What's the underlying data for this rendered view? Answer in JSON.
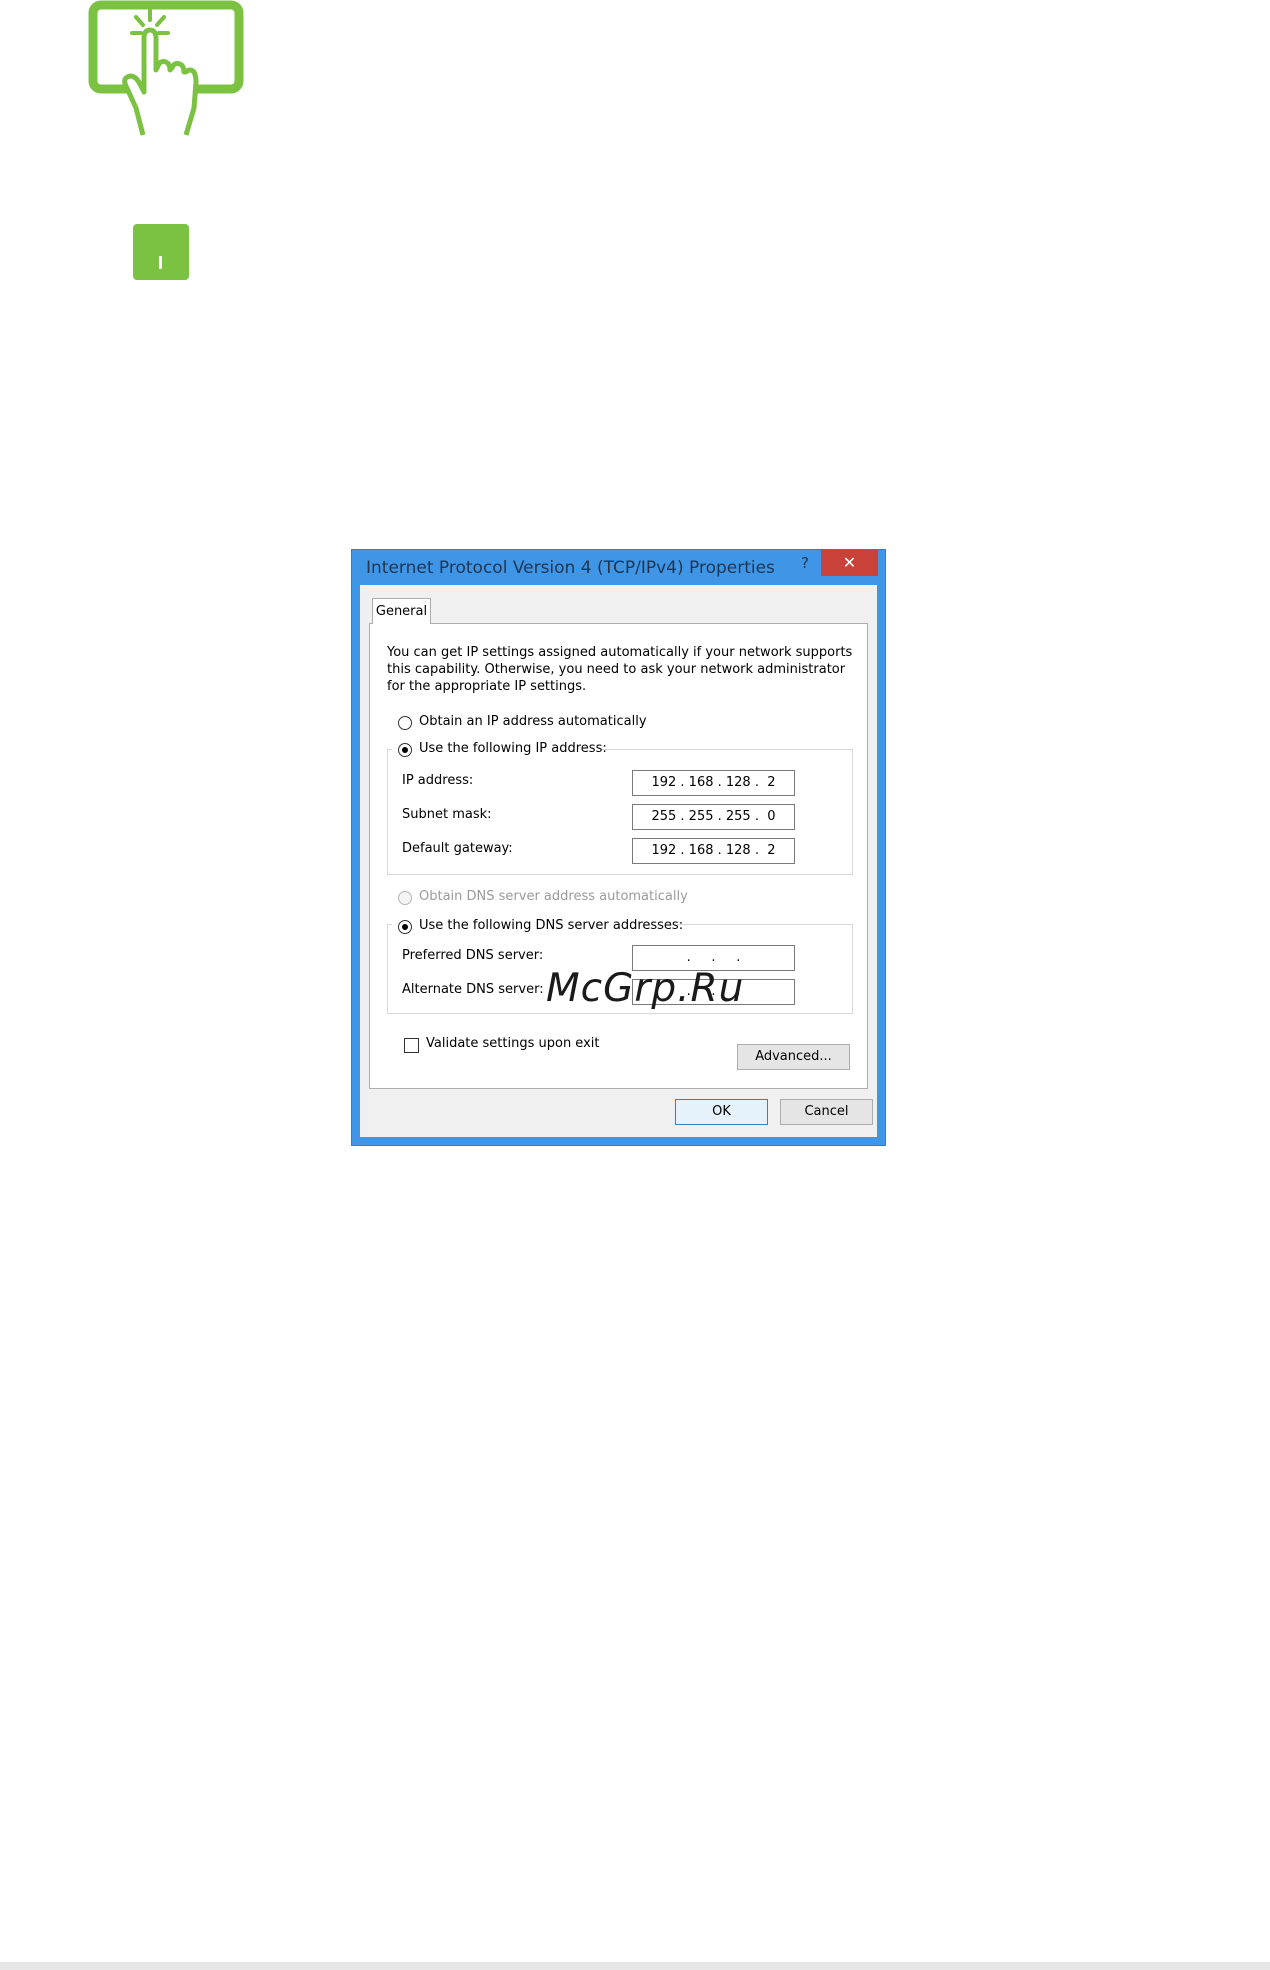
{
  "dialog": {
    "title": "Internet Protocol Version 4 (TCP/IPv4) Properties",
    "help": "?",
    "close": "✕",
    "tab": "General",
    "intro": "You can get IP settings assigned automatically if your network supports this capability. Otherwise, you need to ask your network administrator for the appropriate IP settings.",
    "ip_auto_label": "Obtain an IP address automatically",
    "ip_manual_label": "Use the following IP address:",
    "ip_fields": [
      {
        "label": "IP address:",
        "value": "192 . 168 . 128 .  2"
      },
      {
        "label": "Subnet mask:",
        "value": "255 . 255 . 255 .  0"
      },
      {
        "label": "Default gateway:",
        "value": "192 . 168 . 128 .  2"
      }
    ],
    "dns_auto_label": "Obtain DNS server address automatically",
    "dns_manual_label": "Use the following DNS server addresses:",
    "dns_fields": [
      {
        "label": "Preferred DNS server:",
        "value": "     .     .     .     "
      },
      {
        "label": "Alternate DNS server:",
        "value": "     .     .     .     "
      }
    ],
    "validate_label": "Validate settings upon exit",
    "advanced_label": "Advanced...",
    "ok_label": "OK",
    "cancel_label": "Cancel"
  },
  "watermark": "McGrp.Ru",
  "colors": {
    "accent_green": "#7cc242",
    "dialog_frame": "#3f96e6",
    "close_red": "#c9423a"
  },
  "icons": [
    "touch-tap-icon",
    "green-tab-icon"
  ]
}
